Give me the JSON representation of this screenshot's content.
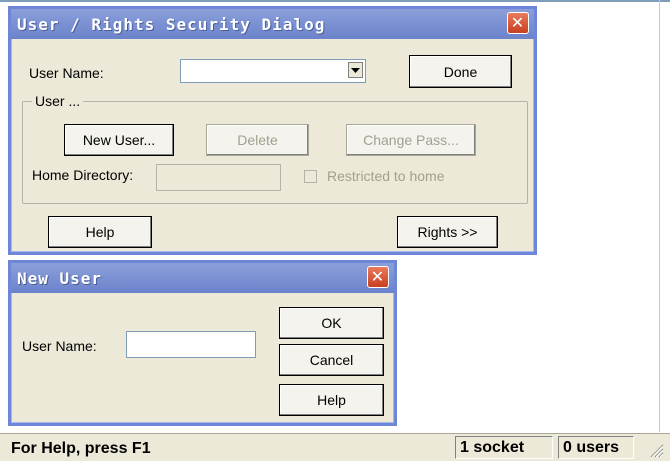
{
  "security_dialog": {
    "title": "User / Rights Security Dialog",
    "close_glyph": "✕",
    "user_name_label": "User Name:",
    "user_name_value": "",
    "done_label": "Done",
    "user_group_legend": "User ...",
    "new_user_label": "New User...",
    "delete_label": "Delete",
    "change_pass_label": "Change Pass...",
    "home_directory_label": "Home Directory:",
    "home_directory_value": "",
    "restricted_label": "Restricted to home",
    "help_label": "Help",
    "rights_label": "Rights >>"
  },
  "new_user_dialog": {
    "title": "New User",
    "close_glyph": "✕",
    "user_name_label": "User Name:",
    "user_name_value": "",
    "ok_label": "OK",
    "cancel_label": "Cancel",
    "help_label": "Help"
  },
  "statusbar": {
    "help_text": "For Help, press F1",
    "sockets": "1 socket",
    "users": "0 users"
  },
  "colors": {
    "title_bar": "#7b91d3",
    "window_frame": "#6d86d8",
    "face": "#ece9d8",
    "close_button": "#d9573a"
  }
}
